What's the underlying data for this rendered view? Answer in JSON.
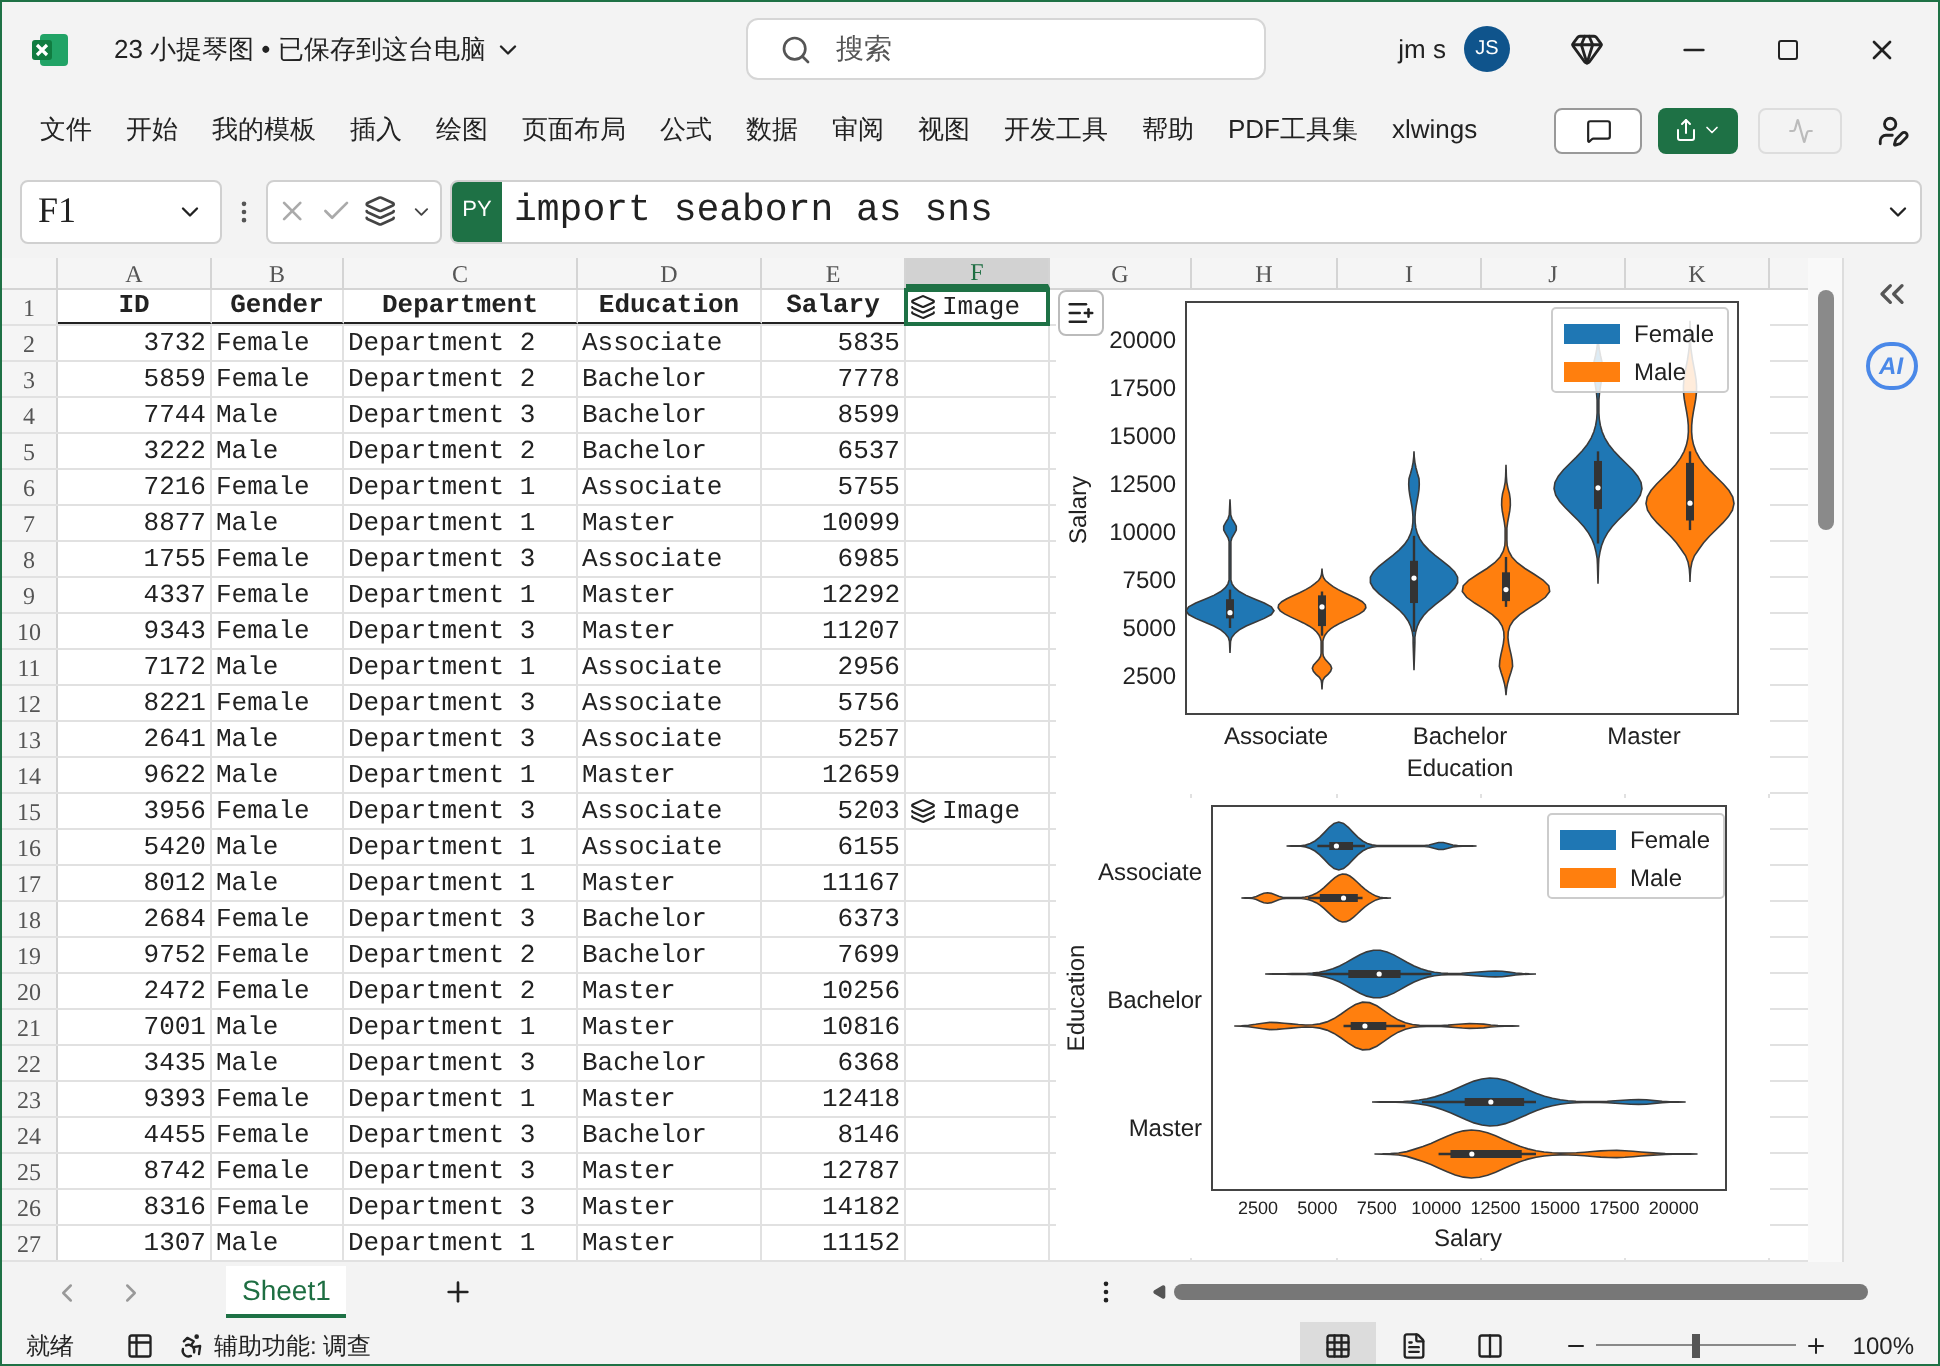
{
  "window": {
    "title": "23 小提琴图 • 已保存到这台电脑",
    "search": {
      "placeholder": "搜索"
    },
    "user": "jm s",
    "avatar": "JS"
  },
  "menu": [
    "文件",
    "开始",
    "我的模板",
    "插入",
    "绘图",
    "页面布局",
    "公式",
    "数据",
    "审阅",
    "视图",
    "开发工具",
    "帮助",
    "PDF工具集",
    "xlwings"
  ],
  "formula_bar": {
    "name_box": "F1",
    "badge": "PY",
    "formula": "import seaborn as sns"
  },
  "columns": [
    {
      "label": "A",
      "selected": false
    },
    {
      "label": "B",
      "selected": false
    },
    {
      "label": "C",
      "selected": false
    },
    {
      "label": "D",
      "selected": false
    },
    {
      "label": "E",
      "selected": false
    },
    {
      "label": "F",
      "selected": true
    },
    {
      "label": "G",
      "selected": false
    },
    {
      "label": "H",
      "selected": false
    },
    {
      "label": "I",
      "selected": false
    },
    {
      "label": "J",
      "selected": false
    },
    {
      "label": "K",
      "selected": false
    }
  ],
  "rows": [
    {
      "header": "1",
      "kind": "header",
      "cells": [
        "ID",
        "Gender",
        "Department",
        "Education",
        "Salary"
      ],
      "image_cell": {
        "label": "Image",
        "selected": true
      }
    },
    {
      "header": "2",
      "kind": "data",
      "cells": [
        "3732",
        "Female",
        "Department 2",
        "Associate",
        "5835"
      ]
    },
    {
      "header": "3",
      "kind": "data",
      "cells": [
        "5859",
        "Female",
        "Department 2",
        "Bachelor",
        "7778"
      ]
    },
    {
      "header": "4",
      "kind": "data",
      "cells": [
        "7744",
        "Male",
        "Department 3",
        "Bachelor",
        "8599"
      ]
    },
    {
      "header": "5",
      "kind": "data",
      "cells": [
        "3222",
        "Male",
        "Department 2",
        "Bachelor",
        "6537"
      ]
    },
    {
      "header": "6",
      "kind": "data",
      "cells": [
        "7216",
        "Female",
        "Department 1",
        "Associate",
        "5755"
      ]
    },
    {
      "header": "7",
      "kind": "data",
      "cells": [
        "8877",
        "Male",
        "Department 1",
        "Master",
        "10099"
      ]
    },
    {
      "header": "8",
      "kind": "data",
      "cells": [
        "1755",
        "Female",
        "Department 3",
        "Associate",
        "6985"
      ]
    },
    {
      "header": "9",
      "kind": "data",
      "cells": [
        "4337",
        "Female",
        "Department 1",
        "Master",
        "12292"
      ]
    },
    {
      "header": "10",
      "kind": "data",
      "cells": [
        "9343",
        "Female",
        "Department 3",
        "Master",
        "11207"
      ]
    },
    {
      "header": "11",
      "kind": "data",
      "cells": [
        "7172",
        "Male",
        "Department 1",
        "Associate",
        "2956"
      ]
    },
    {
      "header": "12",
      "kind": "data",
      "cells": [
        "8221",
        "Female",
        "Department 3",
        "Associate",
        "5756"
      ]
    },
    {
      "header": "13",
      "kind": "data",
      "cells": [
        "2641",
        "Male",
        "Department 3",
        "Associate",
        "5257"
      ]
    },
    {
      "header": "14",
      "kind": "data",
      "cells": [
        "9622",
        "Male",
        "Department 1",
        "Master",
        "12659"
      ]
    },
    {
      "header": "15",
      "kind": "data",
      "cells": [
        "3956",
        "Female",
        "Department 3",
        "Associate",
        "5203"
      ],
      "image_cell": {
        "label": "Image",
        "selected": false
      }
    },
    {
      "header": "16",
      "kind": "data",
      "cells": [
        "5420",
        "Male",
        "Department 1",
        "Associate",
        "6155"
      ]
    },
    {
      "header": "17",
      "kind": "data",
      "cells": [
        "8012",
        "Male",
        "Department 1",
        "Master",
        "11167"
      ]
    },
    {
      "header": "18",
      "kind": "data",
      "cells": [
        "2684",
        "Female",
        "Department 3",
        "Bachelor",
        "6373"
      ]
    },
    {
      "header": "19",
      "kind": "data",
      "cells": [
        "9752",
        "Female",
        "Department 2",
        "Bachelor",
        "7699"
      ]
    },
    {
      "header": "20",
      "kind": "data",
      "cells": [
        "2472",
        "Female",
        "Department 2",
        "Master",
        "10256"
      ]
    },
    {
      "header": "21",
      "kind": "data",
      "cells": [
        "7001",
        "Male",
        "Department 1",
        "Master",
        "10816"
      ]
    },
    {
      "header": "22",
      "kind": "data",
      "cells": [
        "3435",
        "Male",
        "Department 3",
        "Bachelor",
        "6368"
      ]
    },
    {
      "header": "23",
      "kind": "data",
      "cells": [
        "9393",
        "Female",
        "Department 1",
        "Master",
        "12418"
      ]
    },
    {
      "header": "24",
      "kind": "data",
      "cells": [
        "4455",
        "Female",
        "Department 3",
        "Bachelor",
        "8146"
      ]
    },
    {
      "header": "25",
      "kind": "data",
      "cells": [
        "8742",
        "Female",
        "Department 3",
        "Master",
        "12787"
      ]
    },
    {
      "header": "26",
      "kind": "data",
      "cells": [
        "8316",
        "Female",
        "Department 3",
        "Master",
        "14182"
      ]
    },
    {
      "header": "27",
      "kind": "data",
      "cells": [
        "1307",
        "Male",
        "Department 1",
        "Master",
        "11152"
      ]
    }
  ],
  "plots": [
    {
      "kind": "vertical",
      "xlabel": "Education",
      "ylabel": "Salary",
      "categories": [
        "Associate",
        "Bachelor",
        "Master"
      ],
      "value_ticks": [
        "20000",
        "17500",
        "15000",
        "12500",
        "10000",
        "7500",
        "5000",
        "2500"
      ],
      "legend": [
        {
          "label": "Female",
          "color": "#1f77b4"
        },
        {
          "label": "Male",
          "color": "#ff7f0e"
        }
      ]
    },
    {
      "kind": "horizontal",
      "xlabel": "Salary",
      "ylabel": "Education",
      "categories": [
        "Associate",
        "Bachelor",
        "Master"
      ],
      "value_ticks": [
        "2500",
        "5000",
        "7500",
        "10000",
        "12500",
        "15000",
        "17500",
        "20000"
      ],
      "legend": [
        {
          "label": "Female",
          "color": "#1f77b4"
        },
        {
          "label": "Male",
          "color": "#ff7f0e"
        }
      ]
    }
  ],
  "side_pane": {
    "ai_badge": "AI"
  },
  "sheet_tabs": [
    {
      "label": "Sheet1",
      "selected": true
    }
  ],
  "status_bar": {
    "mode": "就绪",
    "accessibility": "辅助功能: 调查",
    "views": [
      {
        "kind": "normal",
        "selected": true
      },
      {
        "kind": "page_layout",
        "selected": false
      },
      {
        "kind": "page_break",
        "selected": false
      }
    ],
    "zoom": {
      "level": 0.5,
      "reading": "100%"
    }
  }
}
